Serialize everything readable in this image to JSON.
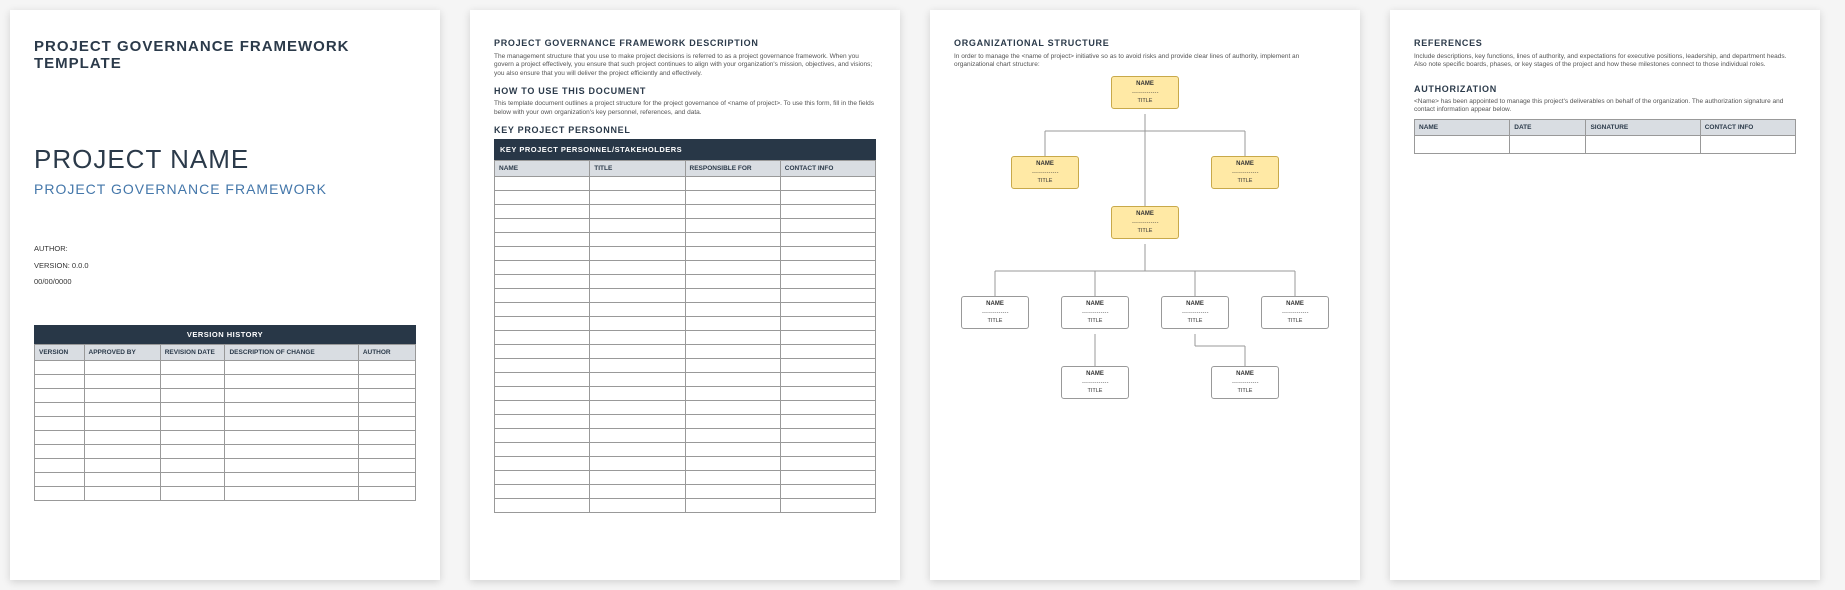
{
  "page1": {
    "title": "PROJECT GOVERNANCE FRAMEWORK TEMPLATE",
    "project_name": "PROJECT NAME",
    "subtitle": "PROJECT GOVERNANCE FRAMEWORK",
    "author_label": "AUTHOR:",
    "version_label": "VERSION: 0.0.0",
    "date_label": "00/00/0000",
    "version_history_title": "VERSION HISTORY",
    "vh_headers": {
      "version": "VERSION",
      "approved_by": "APPROVED BY",
      "revision_date": "REVISION DATE",
      "description": "DESCRIPTION OF CHANGE",
      "author": "AUTHOR"
    }
  },
  "page2": {
    "h_desc": "PROJECT GOVERNANCE FRAMEWORK DESCRIPTION",
    "desc_text": "The management structure that you use to make project decisions is referred to as a project governance framework. When you govern a project effectively, you ensure that such project continues to align with your organization's mission, objectives, and visions; you also ensure that you will deliver the project efficiently and effectively.",
    "h_howto": "HOW TO USE THIS DOCUMENT",
    "howto_text": "This template document outlines a project structure for the project governance of <name of project>. To use this form, fill in the fields below with your own organization's key personnel, references, and data.",
    "h_personnel": "KEY PROJECT PERSONNEL",
    "personnel_title": "KEY PROJECT PERSONNEL/STAKEHOLDERS",
    "personnel_headers": {
      "name": "NAME",
      "title": "TITLE",
      "responsible_for": "RESPONSIBLE FOR",
      "contact": "CONTACT INFO"
    }
  },
  "page3": {
    "h_org": "ORGANIZATIONAL STRUCTURE",
    "org_text": "In order to manage the <name of project> initiative so as to avoid risks and provide clear lines of authority, implement an organizational chart structure:",
    "node_name": "NAME",
    "node_title": "TITLE"
  },
  "page4": {
    "h_ref": "REFERENCES",
    "ref_text": "Include descriptions, key functions, lines of authority, and expectations for executive positions, leadership, and department heads. Also note specific boards, phases, or key stages of the project and how these milestones connect to those individual roles.",
    "h_auth": "AUTHORIZATION",
    "auth_text": "<Name> has been appointed to manage this project's deliverables on behalf of the organization. The authorization signature and contact information appear below.",
    "auth_headers": {
      "name": "NAME",
      "date": "DATE",
      "signature": "SIGNATURE",
      "contact": "CONTACT INFO"
    }
  }
}
